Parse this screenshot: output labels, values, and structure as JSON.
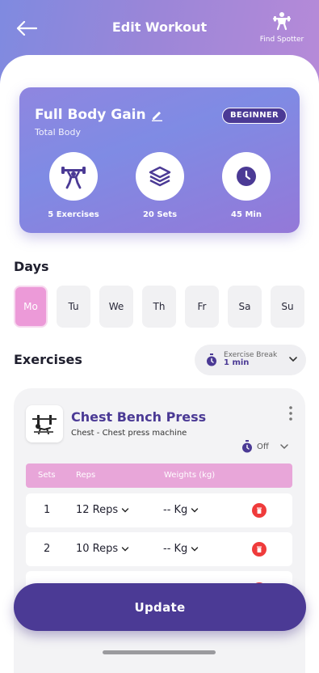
{
  "header": {
    "title": "Edit Workout",
    "spotter_label": "Find Spotter"
  },
  "workout": {
    "name": "Full Body Gain",
    "category": "Total Body",
    "level": "BEGINNER",
    "stats": [
      {
        "icon": "weightlifter-icon",
        "label": "5 Exercises"
      },
      {
        "icon": "layers-icon",
        "label": "20 Sets"
      },
      {
        "icon": "clock-icon",
        "label": "45 Min"
      }
    ]
  },
  "days": {
    "title": "Days",
    "items": [
      "Mo",
      "Tu",
      "We",
      "Th",
      "Fr",
      "Sa",
      "Su"
    ],
    "selected": "Mo"
  },
  "exercises": {
    "title": "Exercises",
    "break_title": "Exercise Break",
    "break_value": "1 min",
    "card": {
      "name": "Chest Bench Press",
      "equipment": "Chest - Chest press machine",
      "timer_label": "Off",
      "columns": {
        "sets": "Sets",
        "reps": "Reps",
        "weights": "Weights (kg)"
      },
      "rows": [
        {
          "set": "1",
          "reps": "12 Reps",
          "weight": "-- Kg"
        },
        {
          "set": "2",
          "reps": "10 Reps",
          "weight": "-- Kg"
        }
      ]
    }
  },
  "actions": {
    "update_label": "Update"
  },
  "colors": {
    "primary": "#4b3a95",
    "accent_pink": "#ec9ad8",
    "table_header": "#e8a6d9",
    "delete": "#ef3b3b",
    "header_gradient_start": "#7f8ae0",
    "header_gradient_end": "#b78ad8"
  }
}
